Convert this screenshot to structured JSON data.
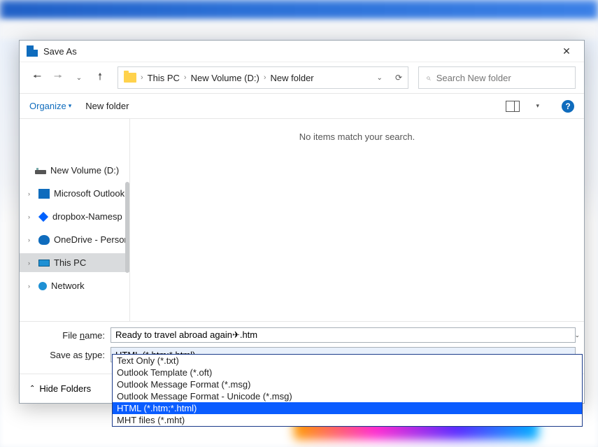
{
  "dialog": {
    "title": "Save As"
  },
  "breadcrumb": {
    "parts": [
      "This PC",
      "New Volume (D:)",
      "New folder"
    ]
  },
  "search": {
    "placeholder": "Search New folder"
  },
  "toolbar": {
    "organize": "Organize",
    "new_folder": "New folder"
  },
  "tree": {
    "items": [
      {
        "label": "New Volume (D:)",
        "icon": "disk",
        "expandable": false
      },
      {
        "label": "Microsoft Outlook",
        "icon": "outlook",
        "expandable": true
      },
      {
        "label": "dropbox-Namesp",
        "icon": "dropbox",
        "expandable": true
      },
      {
        "label": "OneDrive - Person",
        "icon": "onedrive",
        "expandable": true
      },
      {
        "label": "This PC",
        "icon": "pc",
        "expandable": true,
        "selected": true
      },
      {
        "label": "Network",
        "icon": "net",
        "expandable": true
      }
    ]
  },
  "content": {
    "empty_text": "No items match your search."
  },
  "fields": {
    "filename_label": "File name:",
    "filename_value": "Ready to travel abroad again✈.htm",
    "savetype_label": "Save as type:",
    "savetype_value": "HTML (*.htm;*.html)"
  },
  "dropdown": {
    "items": [
      {
        "label": "Text Only (*.txt)"
      },
      {
        "label": "Outlook Template (*.oft)"
      },
      {
        "label": "Outlook Message Format (*.msg)"
      },
      {
        "label": "Outlook Message Format - Unicode (*.msg)"
      },
      {
        "label": "HTML (*.htm;*.html)",
        "selected": true
      },
      {
        "label": "MHT files (*.mht)"
      }
    ]
  },
  "footer": {
    "hide_folders": "Hide Folders"
  }
}
